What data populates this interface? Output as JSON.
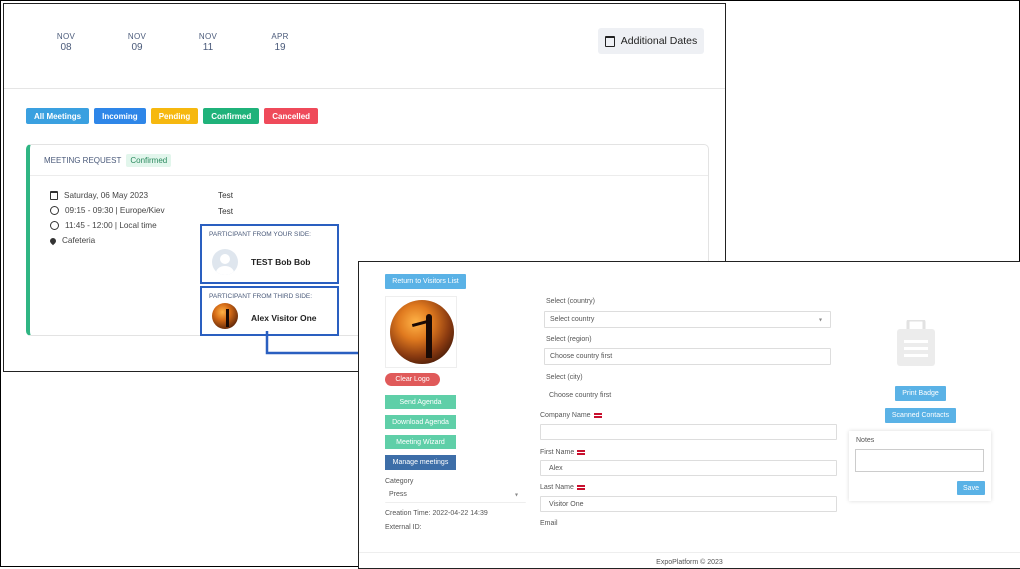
{
  "dates": [
    {
      "month": "NOV",
      "day": "08"
    },
    {
      "month": "NOV",
      "day": "09"
    },
    {
      "month": "NOV",
      "day": "11"
    },
    {
      "month": "APR",
      "day": "19"
    }
  ],
  "additional_dates_label": "Additional Dates",
  "filters": [
    {
      "label": "All Meetings",
      "color": "#3aa0e0"
    },
    {
      "label": "Incoming",
      "color": "#2e86e8"
    },
    {
      "label": "Pending",
      "color": "#f6b80f"
    },
    {
      "label": "Confirmed",
      "color": "#1fb27a"
    },
    {
      "label": "Cancelled",
      "color": "#ef4a5a"
    }
  ],
  "meeting": {
    "title": "MEETING REQUEST",
    "status": "Confirmed",
    "date": "Saturday, 06 May 2023",
    "time_kiev": "09:15 - 09:30 | Europe/Kiev",
    "time_local": "11:45 - 12:00 | Local time",
    "location": "Cafeteria",
    "subject": "Test",
    "description": "Test",
    "your_side_label": "PARTICIPANT FROM YOUR SIDE:",
    "your_side_name": "TEST Bob Bob",
    "third_side_label": "PARTICIPANT FROM THIRD SIDE:",
    "third_side_name": "Alex Visitor One"
  },
  "visitor": {
    "return_label": "Return to Visitors List",
    "clear_logo": "Clear Logo",
    "send_agenda": "Send Agenda",
    "download_agenda": "Download Agenda",
    "meeting_wizard": "Meeting Wizard",
    "manage_meetings": "Manage meetings",
    "category_label": "Category",
    "category_value": "Press",
    "creation_time": "Creation Time: 2022-04-22 14:39",
    "external_id": "External ID:",
    "country_label": "Select (country)",
    "country_value": "Select country",
    "region_label": "Select (region)",
    "region_value": "Choose country first",
    "city_label": "Select (city)",
    "city_value": "Choose country first",
    "company_label": "Company Name",
    "company_value": "",
    "first_name_label": "First Name",
    "first_name_value": "Alex",
    "last_name_label": "Last Name",
    "last_name_value": "Visitor One",
    "email_label": "Email",
    "print_badge": "Print Badge",
    "scanned_contacts": "Scanned Contacts",
    "notes_label": "Notes",
    "save_label": "Save",
    "footer": "ExpoPlatform © 2023"
  }
}
